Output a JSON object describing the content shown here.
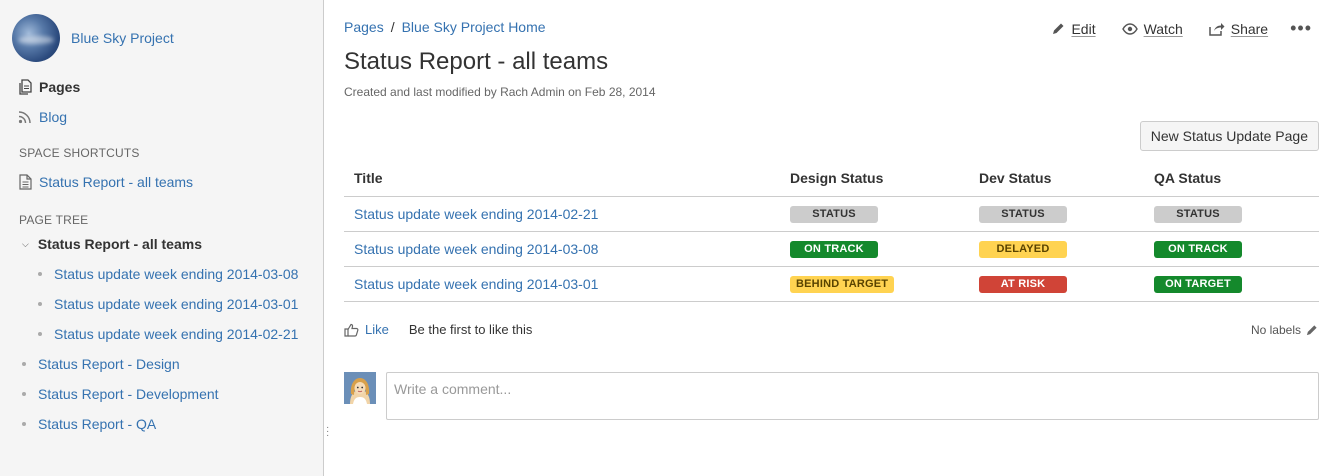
{
  "space": {
    "name": "Blue Sky Project"
  },
  "sidebar": {
    "pages_label": "Pages",
    "blog_label": "Blog",
    "shortcuts_heading": "SPACE SHORTCUTS",
    "shortcut_item": "Status Report - all teams",
    "tree_heading": "PAGE TREE",
    "tree_root": "Status Report - all teams",
    "tree_children": [
      "Status update week ending 2014-03-08",
      "Status update week ending 2014-03-01",
      "Status update week ending 2014-02-21"
    ],
    "tree_siblings": [
      "Status Report - Design",
      "Status Report - Development",
      "Status Report - QA"
    ]
  },
  "breadcrumb": {
    "items": [
      "Pages",
      "Blue Sky Project Home"
    ],
    "separator": "/"
  },
  "actions": {
    "edit": "Edit",
    "watch": "Watch",
    "share": "Share",
    "more": "•••"
  },
  "page": {
    "title": "Status Report - all teams",
    "byline": "Created and last modified by Rach Admin on Feb 28, 2014",
    "new_button": "New Status Update Page"
  },
  "table": {
    "headers": [
      "Title",
      "Design Status",
      "Dev Status",
      "QA Status"
    ],
    "rows": [
      {
        "title": "Status update week ending 2014-02-21",
        "design": {
          "label": "STATUS",
          "bg": "#cccccc",
          "fg": "#333333"
        },
        "dev": {
          "label": "STATUS",
          "bg": "#cccccc",
          "fg": "#333333"
        },
        "qa": {
          "label": "STATUS",
          "bg": "#cccccc",
          "fg": "#333333"
        }
      },
      {
        "title": "Status update week ending 2014-03-08",
        "design": {
          "label": "ON TRACK",
          "bg": "#14892c",
          "fg": "#ffffff"
        },
        "dev": {
          "label": "DELAYED",
          "bg": "#ffd351",
          "fg": "#594300"
        },
        "qa": {
          "label": "ON TRACK",
          "bg": "#14892c",
          "fg": "#ffffff"
        }
      },
      {
        "title": "Status update week ending 2014-03-01",
        "design": {
          "label": "BEHIND TARGET",
          "bg": "#ffd351",
          "fg": "#594300"
        },
        "dev": {
          "label": "AT RISK",
          "bg": "#d04437",
          "fg": "#ffffff"
        },
        "qa": {
          "label": "ON TARGET",
          "bg": "#14892c",
          "fg": "#ffffff"
        }
      }
    ]
  },
  "footer": {
    "like_label": "Like",
    "like_summary": "Be the first to like this",
    "labels_text": "No labels",
    "comment_placeholder": "Write a comment..."
  },
  "colors": {
    "link": "#3572b0",
    "sidebar_bg": "#f5f5f5",
    "border": "#cccccc"
  },
  "icons": [
    "pages-icon",
    "blog-rss-icon",
    "page-icon",
    "chevron-down-icon",
    "pencil-icon",
    "eye-icon",
    "share-icon",
    "more-icon",
    "thumbs-up-icon"
  ]
}
